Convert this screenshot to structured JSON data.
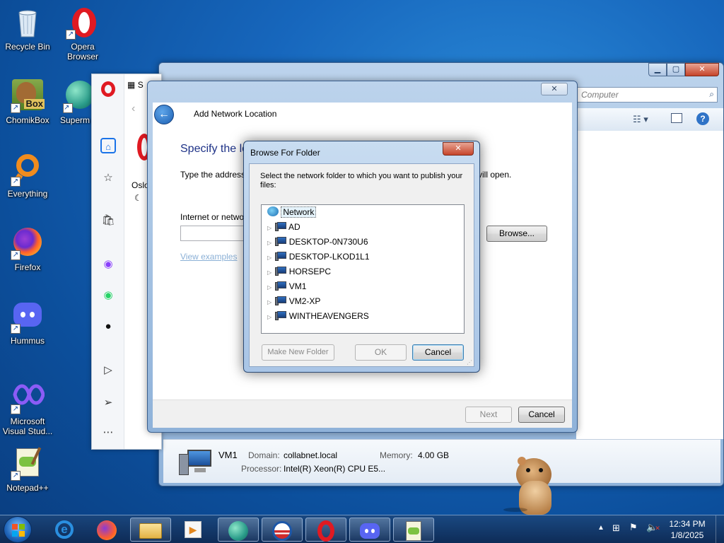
{
  "desktop_icons": [
    {
      "label": "Recycle Bin",
      "icon": "recycle-bin-icon"
    },
    {
      "label": "Opera Browser",
      "icon": "opera-icon"
    },
    {
      "label": "ChomikBox",
      "icon": "chomikbox-icon",
      "badge": "Box"
    },
    {
      "label": "Superm",
      "icon": "superm-icon"
    },
    {
      "label": "Everything",
      "icon": "everything-icon"
    },
    {
      "label": "Firefox",
      "icon": "firefox-icon"
    },
    {
      "label": "Hummus",
      "icon": "discord-icon"
    },
    {
      "label": "Microsoft Visual Stud...",
      "icon": "visual-studio-icon"
    },
    {
      "label": "Notepad++",
      "icon": "notepadpp-icon"
    }
  ],
  "explorer": {
    "search_placeholder": "Computer",
    "details": {
      "name": "VM1",
      "domain_label": "Domain:",
      "domain_value": "collabnet.local",
      "memory_label": "Memory:",
      "memory_value": "4.00 GB",
      "processor_label": "Processor:",
      "processor_value": "Intel(R) Xeon(R) CPU E5..."
    }
  },
  "opera": {
    "tab_label": "S",
    "location_text": "Oslo"
  },
  "add_network_location": {
    "title": "Add Network Location",
    "heading": "Specify the lo",
    "instruction_left": "Type the address",
    "instruction_right": "vill open.",
    "field_label": "Internet or netwo",
    "browse_label": "Browse...",
    "view_examples": "View examples",
    "next_label": "Next",
    "cancel_label": "Cancel"
  },
  "browse_folder": {
    "title": "Browse For Folder",
    "close_glyph": "✕",
    "prompt": "Select the network folder to which you want to publish your files:",
    "root": "Network",
    "items": [
      "AD",
      "DESKTOP-0N730U6",
      "DESKTOP-LKOD1L1",
      "HORSEPC",
      "VM1",
      "VM2-XP",
      "WINTHEAVENGERS"
    ],
    "make_new_folder": "Make New Folder",
    "ok": "OK",
    "cancel": "Cancel"
  },
  "taskbar": {
    "time": "12:34 PM",
    "date": "1/8/2025"
  }
}
